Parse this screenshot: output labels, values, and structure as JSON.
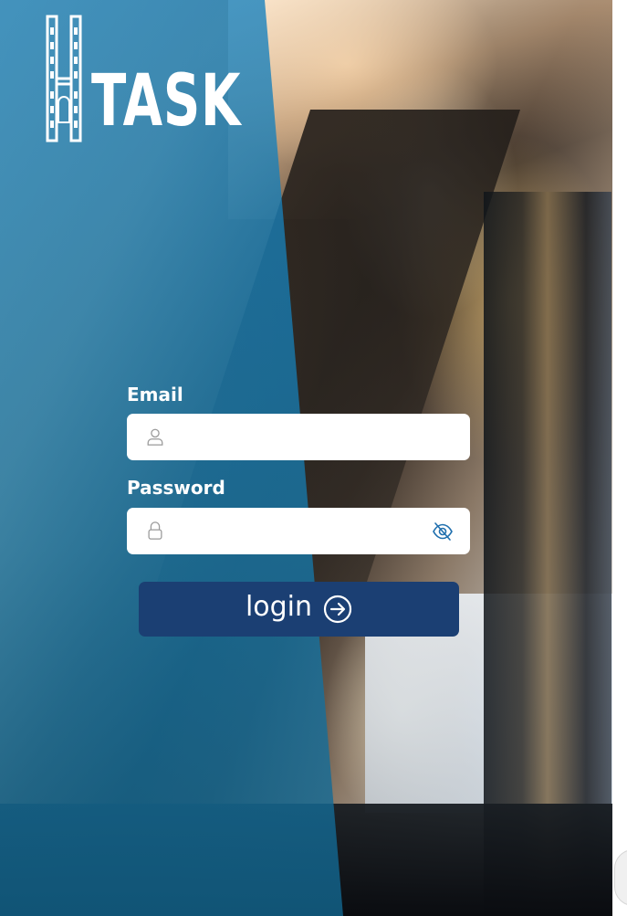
{
  "app": {
    "logo_text": "TASK"
  },
  "login_form": {
    "email_label": "Email",
    "email_value": "",
    "email_icon": "user-icon",
    "password_label": "Password",
    "password_value": "",
    "password_icon": "lock-icon",
    "password_toggle_icon": "eye-off-icon",
    "submit_label": "login",
    "submit_icon": "arrow-right-circle-icon"
  },
  "colors": {
    "overlay_blue": "#1a82be",
    "button_navy": "#1b3f73",
    "input_bg": "#ffffff",
    "icon_gray": "#9a9a9a",
    "toggle_blue": "#1f6fae"
  }
}
